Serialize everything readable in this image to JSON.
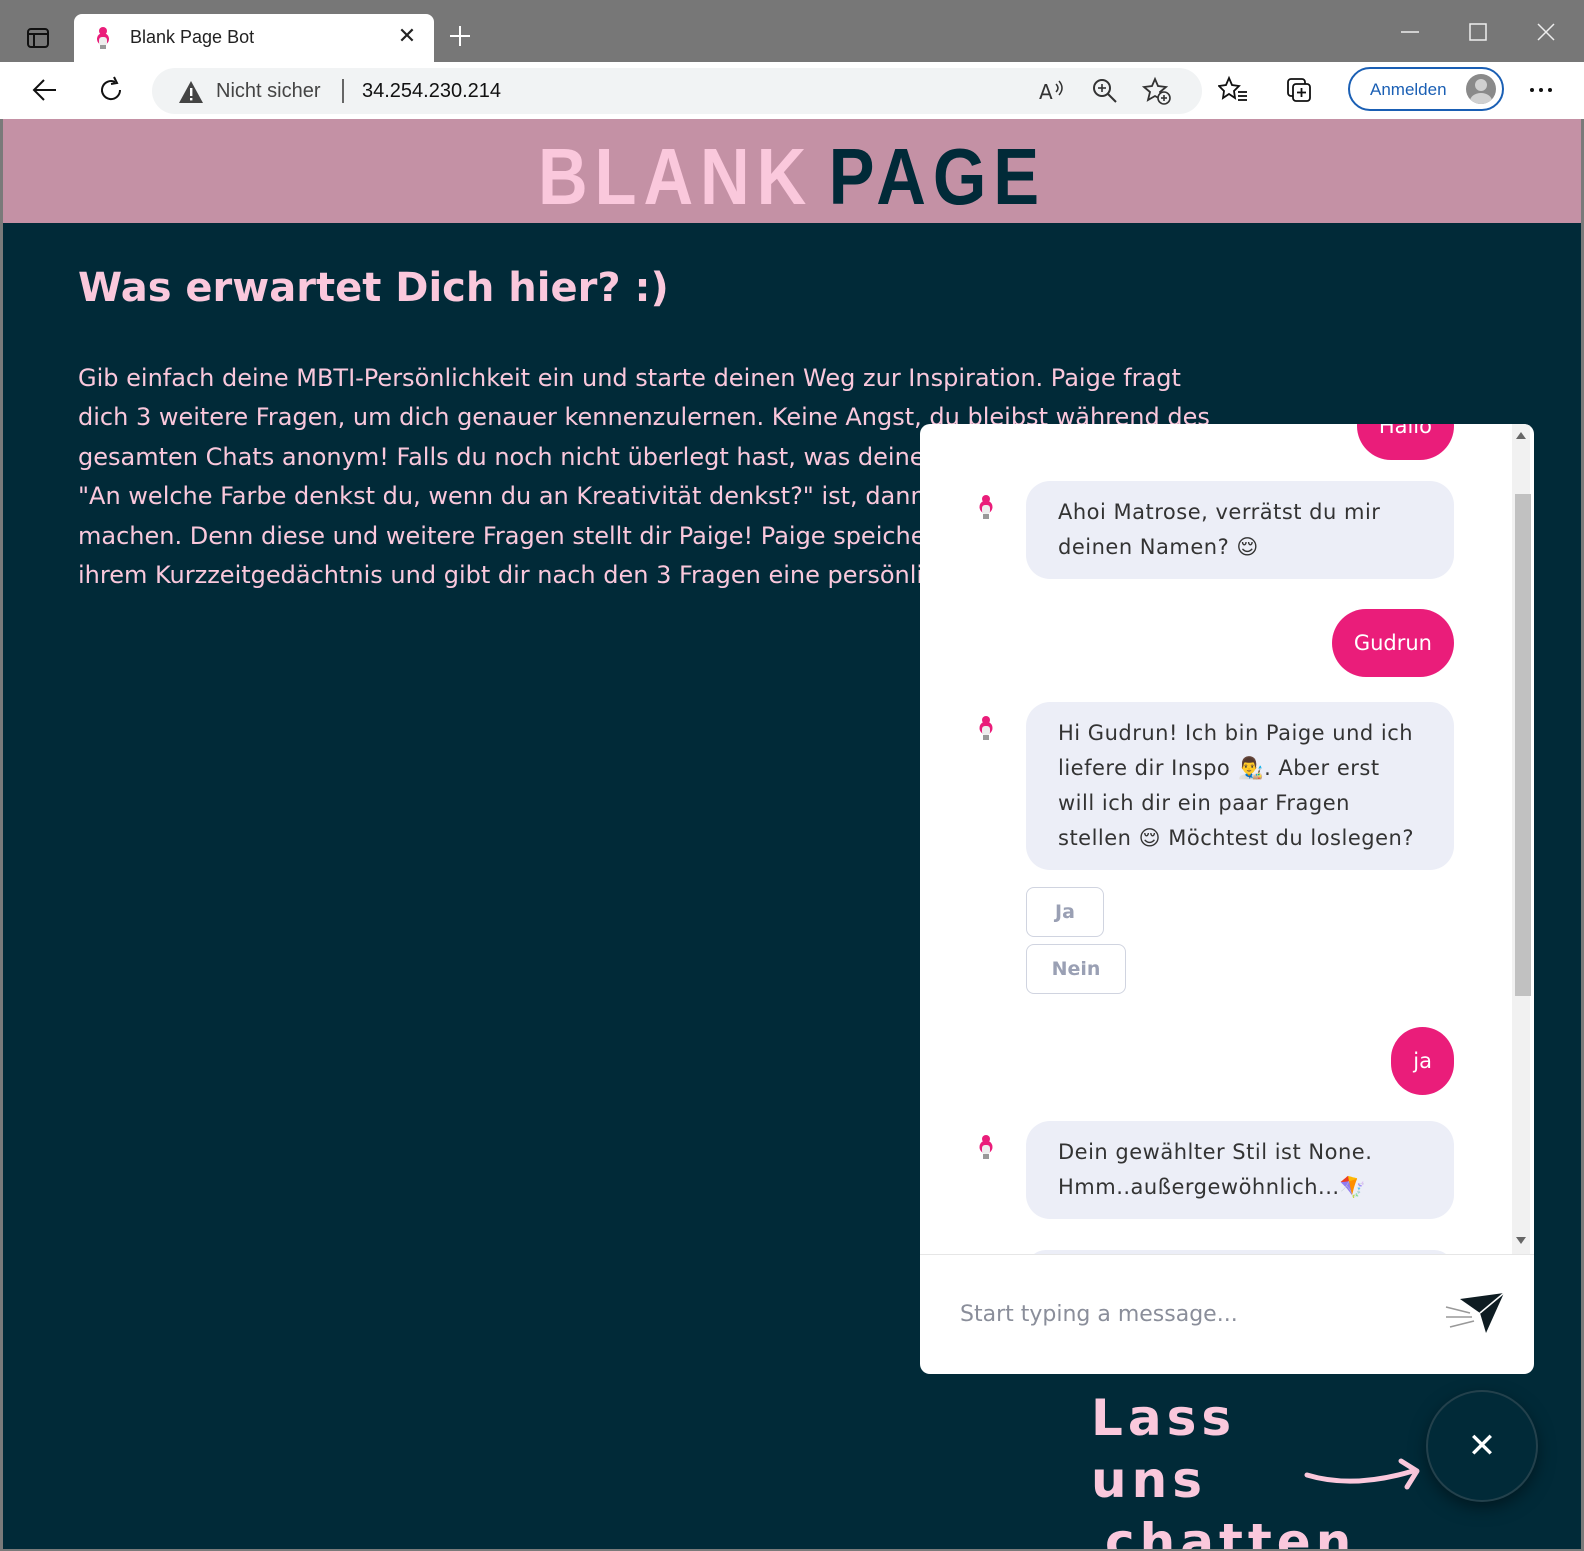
{
  "browser": {
    "tab_title": "Blank Page Bot",
    "tab_close": "✕",
    "not_secure_label": "Nicht sicher",
    "url": "34.254.230.214",
    "signin_label": "Anmelden"
  },
  "site": {
    "logo_blank": "BLANK",
    "logo_page": "PAGE",
    "heading": "Was erwartet Dich hier? :)",
    "intro": "Gib einfach deine MBTI-Persönlichkeit ein und starte deinen Weg zur Inspiration. Paige fragt dich 3 weitere Fragen, um dich genauer kennenzulernen. Keine Angst, du bleibst während des gesamten Chats anonym! Falls du noch nicht überlegt hast, was deine Antwort auf die Frage \"An welche Farbe denkst du, wenn du an Kreativität denkst?\" ist, dann solltest du das jetzt machen. Denn diese und weitere Fragen stellt dir Paige! Paige speichert deine Antworten in ihrem Kurzzeitgedächtnis und gibt dir nach den 3 Fragen eine persönliche Inspiration aus."
  },
  "chat": {
    "messages": [
      {
        "from": "user",
        "text": "Hallo"
      },
      {
        "from": "bot",
        "text": "Ahoi Matrose, verrätst du mir deinen Namen? 😌"
      },
      {
        "from": "user",
        "text": "Gudrun"
      },
      {
        "from": "bot",
        "text": "Hi Gudrun!  Ich bin Paige und ich liefere dir Inspo 👨‍🎨. Aber erst will ich dir ein paar Fragen stellen 😌 Möchtest du loslegen?"
      },
      {
        "from": "user",
        "text": "ja"
      },
      {
        "from": "bot",
        "text": "Dein gewählter Stil ist None. Hmm..außergewöhnlich...🪁"
      }
    ],
    "quick_replies": [
      "Ja",
      "Nein"
    ],
    "input_placeholder": "Start typing a message...",
    "cta_line1": "Lass uns",
    "cta_line2": "chatten",
    "close_icon": "✕"
  },
  "colors": {
    "header_bg": "#c491a5",
    "page_bg": "#012a38",
    "accent_pink": "#fac8dc",
    "user_bubble": "#ea1d7a",
    "bot_bubble": "#eceef7"
  },
  "icons": [
    "sidebar-toggle-icon",
    "favicon-icon",
    "new-tab-icon",
    "minimize-icon",
    "maximize-icon",
    "window-close-icon",
    "back-icon",
    "reload-icon",
    "warning-icon",
    "read-aloud-icon",
    "zoom-icon",
    "add-favorite-icon",
    "favorites-icon",
    "collections-icon",
    "profile-icon",
    "more-icon",
    "bot-avatar-icon",
    "send-icon",
    "close-icon"
  ]
}
